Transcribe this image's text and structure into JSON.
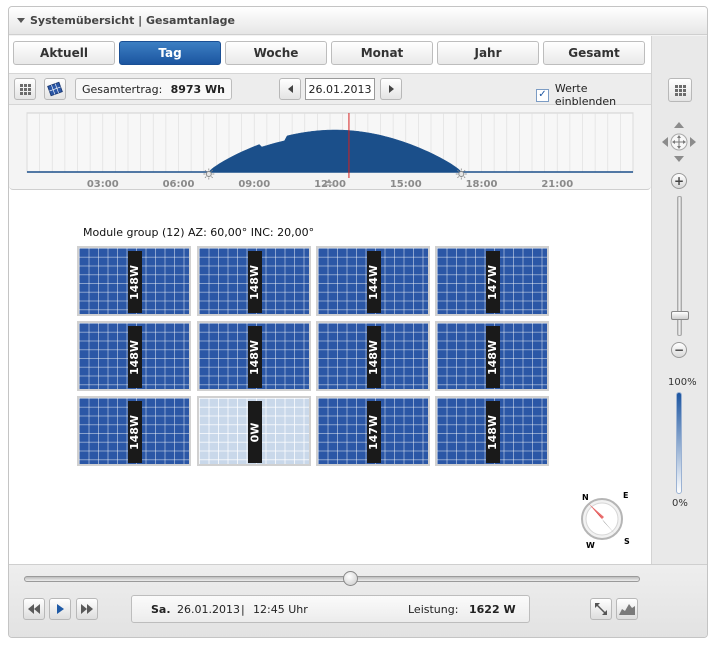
{
  "title": "Systemübersicht | Gesamtanlage",
  "tabs": [
    {
      "label": "Aktuell",
      "active": false
    },
    {
      "label": "Tag",
      "active": true
    },
    {
      "label": "Woche",
      "active": false
    },
    {
      "label": "Monat",
      "active": false
    },
    {
      "label": "Jahr",
      "active": false
    },
    {
      "label": "Gesamt",
      "active": false
    }
  ],
  "toolbar": {
    "yield_label": "Gesamtertrag:",
    "yield_value": "8973 Wh",
    "date": "26.01.2013",
    "show_values_label": "Werte einblenden",
    "show_values_checked": true
  },
  "timeline": {
    "ticks": [
      "03:00",
      "06:00",
      "09:00",
      "12:00",
      "15:00",
      "18:00",
      "21:00"
    ],
    "current_time_hours": 12.75,
    "sunrise_hours": 7.2,
    "sunset_hours": 17.2
  },
  "module_group": {
    "label": "Module group (12) AZ: 60,00° INC: 20,00°",
    "modules": [
      [
        "148W",
        "148W",
        "144W",
        "147W"
      ],
      [
        "148W",
        "148W",
        "148W",
        "148W"
      ],
      [
        "148W",
        "0W",
        "147W",
        "148W"
      ]
    ]
  },
  "compass": {
    "n": "N",
    "e": "E",
    "s": "S",
    "w": "W"
  },
  "right_panel": {
    "zoom_in": "+",
    "zoom_out": "−",
    "opacity_max": "100%",
    "opacity_min": "0%"
  },
  "status": {
    "day": "Sa.",
    "date": "26.01.2013",
    "separator": "|",
    "time": "12:45 Uhr",
    "power_label": "Leistung:",
    "power_value": "1622 W"
  },
  "colors": {
    "accent": "#1c55a0",
    "module": "#2b57a6",
    "marker": "#d42020",
    "curve": "#1b4f8a"
  }
}
